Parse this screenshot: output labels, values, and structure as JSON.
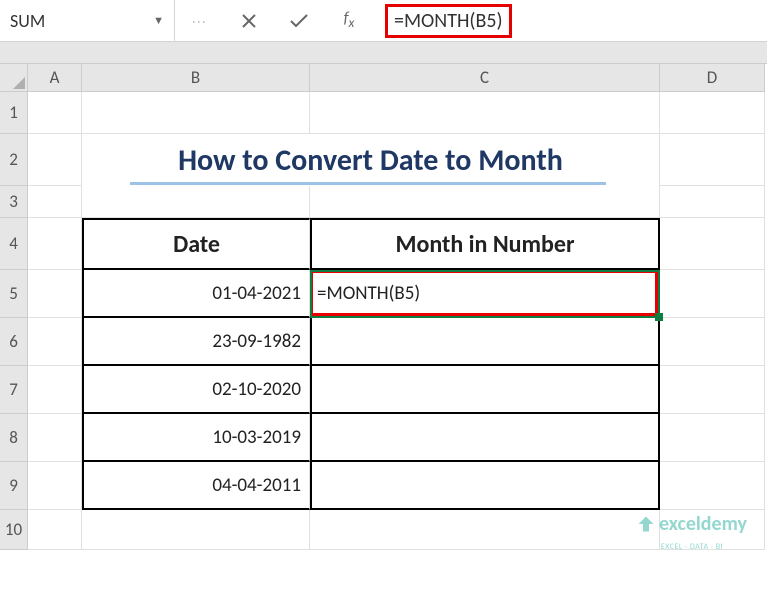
{
  "formulaBar": {
    "nameBox": "SUM",
    "formula": "=MONTH(B5)"
  },
  "columns": [
    "A",
    "B",
    "C",
    "D"
  ],
  "rows": [
    "1",
    "2",
    "3",
    "4",
    "5",
    "6",
    "7",
    "8",
    "9",
    "10"
  ],
  "title": "How to Convert Date to Month",
  "table": {
    "headers": {
      "date": "Date",
      "month": "Month in Number"
    },
    "rows": [
      {
        "date": "01-04-2021",
        "month": "=MONTH(B5)"
      },
      {
        "date": "23-09-1982",
        "month": ""
      },
      {
        "date": "02-10-2020",
        "month": ""
      },
      {
        "date": "10-03-2019",
        "month": ""
      },
      {
        "date": "04-04-2011",
        "month": ""
      }
    ]
  },
  "activeCell": "C5",
  "watermark": {
    "brand": "exceldemy",
    "tagline": "EXCEL · DATA · BI"
  },
  "chart_data": {
    "type": "table",
    "title": "How to Convert Date to Month",
    "columns": [
      "Date",
      "Month in Number"
    ],
    "rows": [
      [
        "01-04-2021",
        "=MONTH(B5)"
      ],
      [
        "23-09-1982",
        ""
      ],
      [
        "02-10-2020",
        ""
      ],
      [
        "10-03-2019",
        ""
      ],
      [
        "04-04-2011",
        ""
      ]
    ]
  }
}
